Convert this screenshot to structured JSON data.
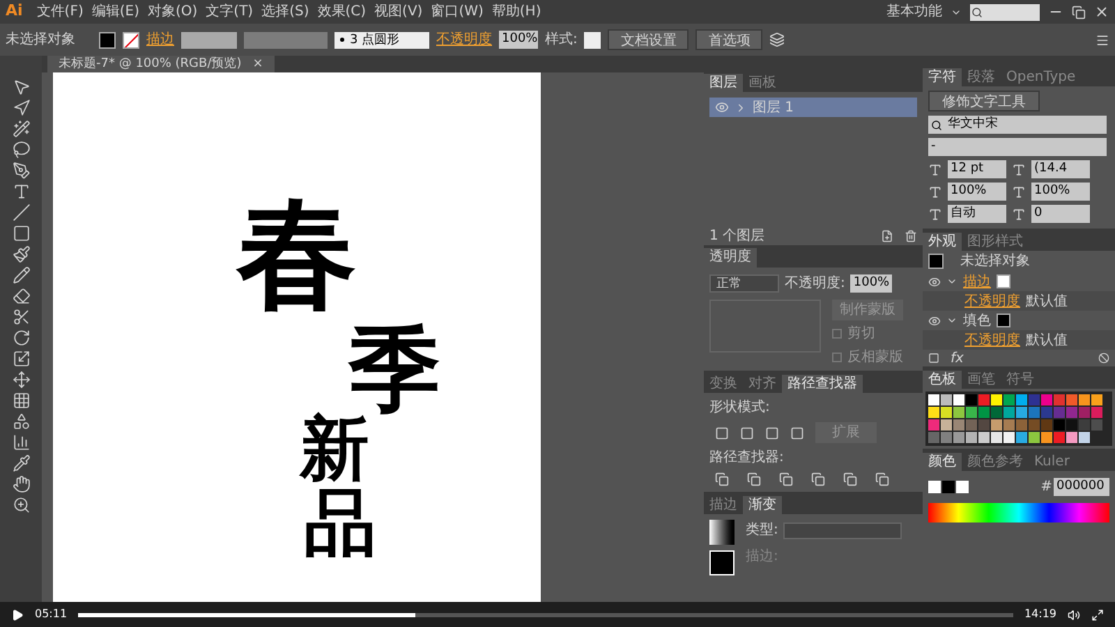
{
  "app": {
    "logo": "Ai",
    "menus": [
      "文件(F)",
      "编辑(E)",
      "对象(O)",
      "文字(T)",
      "选择(S)",
      "效果(C)",
      "视图(V)",
      "窗口(W)",
      "帮助(H)"
    ],
    "workspace": "基本功能"
  },
  "control_bar": {
    "selection": "未选择对象",
    "stroke_label": "描边",
    "brush": "3 点圆形",
    "opacity_label": "不透明度",
    "opacity": "100%",
    "style_label": "样式:",
    "buttons": [
      "文档设置",
      "首选项"
    ]
  },
  "document_tab": {
    "title": "未标题-7* @ 100% (RGB/预览)",
    "close": "×"
  },
  "artwork": [
    "春",
    "季",
    "新",
    "品"
  ],
  "layers_panel": {
    "tabs": [
      {
        "label": "图层",
        "selected": true
      },
      {
        "label": "画板",
        "selected": false
      }
    ],
    "layers": [
      {
        "name": "图层 1",
        "selected": true
      }
    ],
    "count": "1 个图层"
  },
  "transparency_panel": {
    "tab": "透明度",
    "blend_mode": "正常",
    "opacity_label": "不透明度:",
    "opacity": "100%",
    "mask_button": "制作蒙版",
    "options": [
      {
        "label": "剪切",
        "checked": false
      },
      {
        "label": "反相蒙版",
        "checked": false
      }
    ]
  },
  "pathfinder_panel": {
    "tabs": [
      {
        "label": "变换",
        "selected": false
      },
      {
        "label": "对齐",
        "selected": false
      },
      {
        "label": "路径查找器",
        "selected": true
      }
    ],
    "shape_modes_label": "形状模式:",
    "expand_button": "扩展",
    "pathfinders_label": "路径查找器:"
  },
  "gradient_panel": {
    "tabs": [
      {
        "label": "描边",
        "selected": false
      },
      {
        "label": "渐变",
        "selected": true
      }
    ],
    "type_label": "类型:",
    "stroke_label": "描边:"
  },
  "character_panel": {
    "tabs": [
      {
        "label": "字符",
        "selected": true
      },
      {
        "label": "段落",
        "selected": false
      },
      {
        "label": "OpenType",
        "selected": false
      }
    ],
    "touch_type": "修饰文字工具",
    "font": "华文中宋",
    "style": "-",
    "size": "12 pt",
    "leading": "(14.4",
    "vertical_scale": "100%",
    "horizontal_scale": "100%",
    "kerning": "自动",
    "tracking": "0"
  },
  "appearance_panel": {
    "tabs": [
      {
        "label": "外观",
        "selected": true
      },
      {
        "label": "图形样式",
        "selected": false
      }
    ],
    "title": "未选择对象",
    "effects_label": "fx",
    "rows": [
      {
        "kind": "stroke",
        "label": "描边"
      },
      {
        "kind": "opacity",
        "label": "不透明度",
        "value": "默认值"
      },
      {
        "kind": "fill",
        "label": "填色"
      },
      {
        "kind": "opacity",
        "label": "不透明度",
        "value": "默认值"
      }
    ]
  },
  "swatches_panel": {
    "tabs": [
      {
        "label": "色板",
        "selected": true
      },
      {
        "label": "画笔",
        "selected": false
      },
      {
        "label": "符号",
        "selected": false
      }
    ],
    "swatches": [
      {
        "color": "#ffffff"
      },
      {
        "color": "#000000"
      },
      {
        "color": "#ed1c24"
      },
      {
        "color": "#fff200"
      },
      {
        "color": "#00a651"
      },
      {
        "color": "#00aeef"
      },
      {
        "color": "#2e3192"
      },
      {
        "color": "#ec008c"
      },
      {
        "color": "#e0312f"
      },
      {
        "color": "#f15a29"
      },
      {
        "color": "#f7941d"
      },
      {
        "color": "#f9a01b"
      },
      {
        "color": "#ffde17"
      },
      {
        "color": "#d7df23"
      },
      {
        "color": "#8dc63f"
      },
      {
        "color": "#39b54a"
      },
      {
        "color": "#009444"
      },
      {
        "color": "#006838"
      },
      {
        "color": "#00a79d"
      },
      {
        "color": "#27aae1"
      },
      {
        "color": "#1c75bc"
      },
      {
        "color": "#2b3990"
      },
      {
        "color": "#662d91"
      },
      {
        "color": "#92278f"
      },
      {
        "color": "#9e1f63"
      },
      {
        "color": "#da1c5c"
      },
      {
        "color": "#ee2a7b"
      },
      {
        "color": "#c7b299"
      },
      {
        "color": "#998675"
      },
      {
        "color": "#736357"
      },
      {
        "color": "#534741"
      },
      {
        "color": "#c69c6d"
      },
      {
        "color": "#a67c52"
      },
      {
        "color": "#8c6239"
      },
      {
        "color": "#754c24"
      },
      {
        "color": "#603813"
      },
      {
        "color": "#000000"
      },
      {
        "color": "#111111"
      },
      {
        "color": "#3d3d3d"
      },
      {
        "color": "#4d4d4d"
      },
      {
        "color": "#666666"
      },
      {
        "color": "#808080"
      },
      {
        "color": "#999999"
      },
      {
        "color": "#b3b3b3"
      },
      {
        "color": "#cccccc"
      },
      {
        "color": "#e6e6e6"
      },
      {
        "color": "#f2f2f2"
      },
      {
        "color": "#29abe2"
      },
      {
        "color": "#8cc63f"
      },
      {
        "color": "#f7931e"
      },
      {
        "color": "#ed1c24"
      },
      {
        "color": "#f49ac1"
      },
      {
        "color": "#c2d3e8"
      }
    ]
  },
  "color_panel": {
    "tabs": [
      {
        "label": "颜色",
        "selected": true
      },
      {
        "label": "颜色参考",
        "selected": false
      },
      {
        "label": "Kuler",
        "selected": false
      }
    ],
    "hex_label": "#",
    "hex": "000000"
  },
  "video_bar": {
    "current": "05:11",
    "level": 0.36,
    "total": "14:19"
  }
}
